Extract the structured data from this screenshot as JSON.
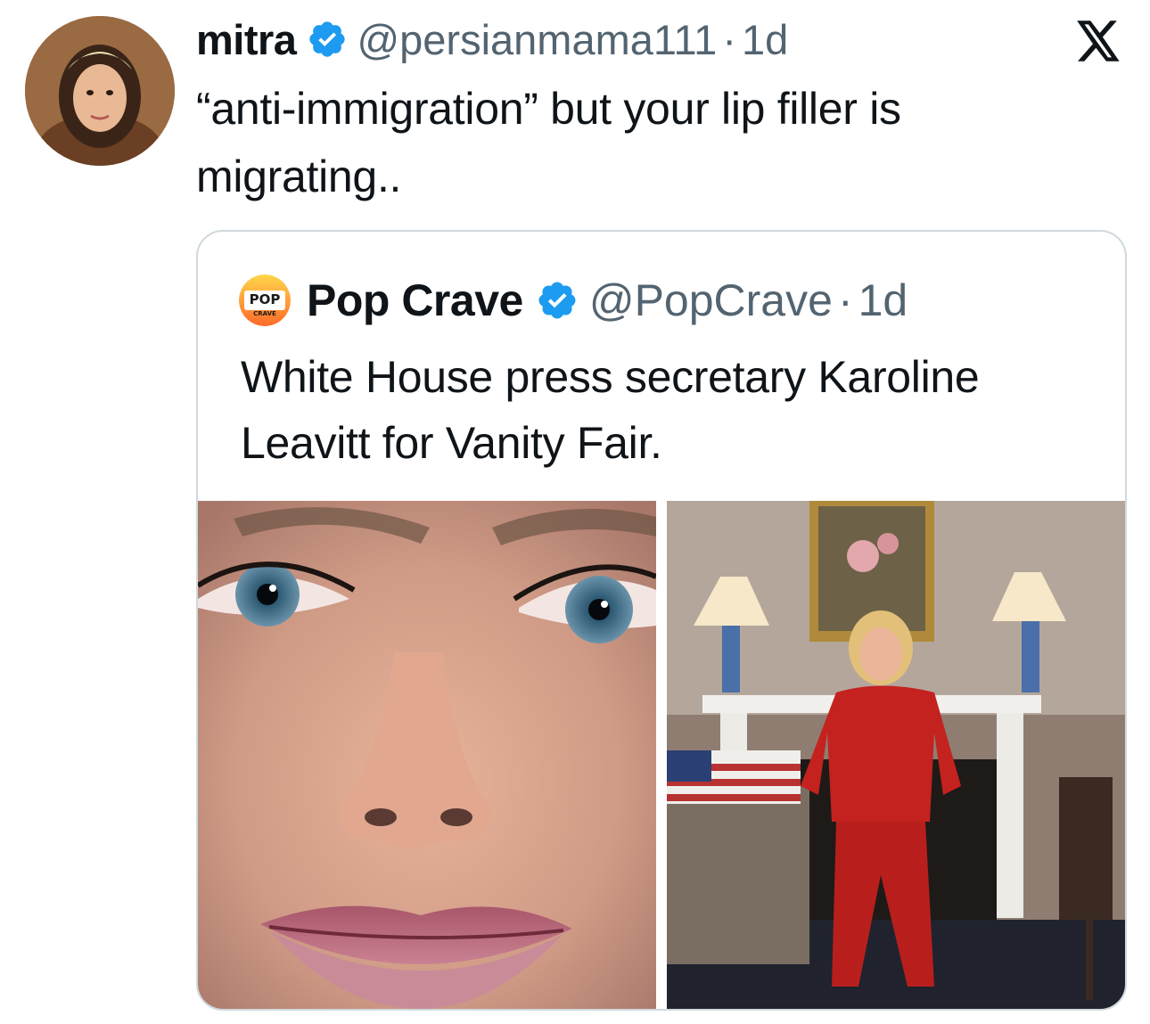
{
  "post": {
    "display_name": "mitra",
    "handle": "@persianmama111",
    "separator": "·",
    "time": "1d",
    "text": "“anti-immigration” but your lip filler is migrating.."
  },
  "quoted_post": {
    "display_name": "Pop Crave",
    "handle": "@PopCrave",
    "separator": "·",
    "time": "1d",
    "text": "White House press secretary Karoline Leavitt for Vanity Fair.",
    "logo_text_top": "POP",
    "logo_text_bottom": "CRAVE",
    "media": [
      {
        "description_icon": "portrait-closeup-photo"
      },
      {
        "description_icon": "full-body-portrait-photo"
      }
    ]
  },
  "icons": {
    "verified": "verified-badge-icon",
    "platform": "x-logo-icon"
  },
  "colors": {
    "text_primary": "#0f1419",
    "text_secondary": "#536471",
    "verified_blue": "#1d9bf0",
    "border": "#cfd9de"
  }
}
